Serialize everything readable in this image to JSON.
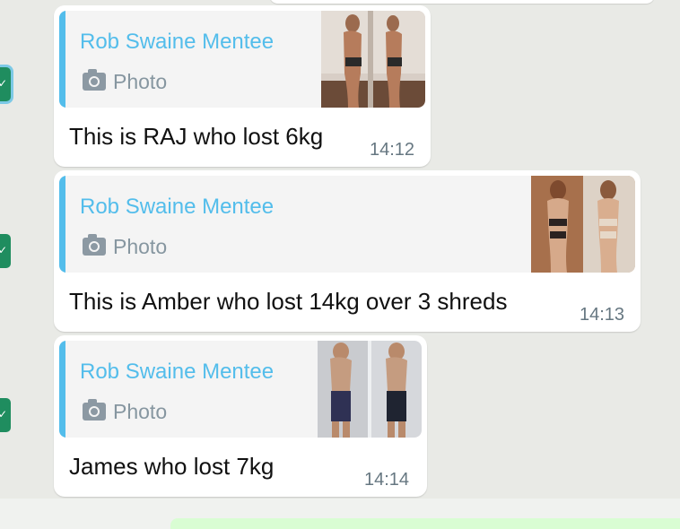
{
  "messages": [
    {
      "quote_author": "Rob Swaine Mentee",
      "quote_media_label": "Photo",
      "text": "This is RAJ who lost 6kg",
      "time": "14:12"
    },
    {
      "quote_author": "Rob Swaine Mentee",
      "quote_media_label": "Photo",
      "text": "This is Amber who lost 14kg over 3 shreds",
      "time": "14:13"
    },
    {
      "quote_author": "Rob Swaine Mentee",
      "quote_media_label": "Photo",
      "text": "James who lost 7kg",
      "time": "14:14"
    }
  ],
  "colors": {
    "quote_accent": "#53bdeb",
    "bubble": "#ffffff",
    "chat_background": "#e9eae6",
    "timestamp": "#667781",
    "badge": "#1f8d5f"
  },
  "icons": [
    "camera-icon",
    "check-badge-icon"
  ]
}
